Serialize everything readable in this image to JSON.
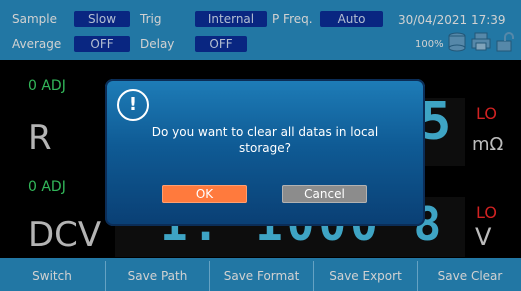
{
  "header": {
    "sample_label": "Sample",
    "sample_value": "Slow",
    "trig_label": "Trig",
    "trig_value": "Internal",
    "pfreq_label": "P Freq.",
    "pfreq_value": "Auto",
    "average_label": "Average",
    "average_value": "OFF",
    "delay_label": "Delay",
    "delay_value": "OFF",
    "datetime": "30/04/2021 17:39",
    "zoom": "100%"
  },
  "rows": [
    {
      "adj": "0 ADJ",
      "func": "R",
      "lo": "LO",
      "unit": "mΩ",
      "visible_digits": "5"
    },
    {
      "adj": "0 ADJ",
      "func": "DCV",
      "lo": "LO",
      "unit": "V",
      "visible_digits": "1. 1000 8"
    }
  ],
  "bottom": {
    "buttons": [
      "Switch",
      "Save Path",
      "Save Format",
      "Save Export",
      "Save Clear"
    ]
  },
  "dialog": {
    "icon": "!",
    "message": "Do you want to clear all datas in local storage?",
    "ok": "OK",
    "cancel": "Cancel"
  },
  "icons": [
    "database-icon",
    "printer-icon",
    "unlock-icon"
  ],
  "colors": {
    "topbar": "#2a92c8",
    "pill": "#0b2f9e",
    "ok": "#ff7a3d",
    "cancel": "#8c8c8c",
    "digits": "#4cc9f0",
    "lo": "#ff2a2a",
    "adj": "#3ee06e"
  }
}
